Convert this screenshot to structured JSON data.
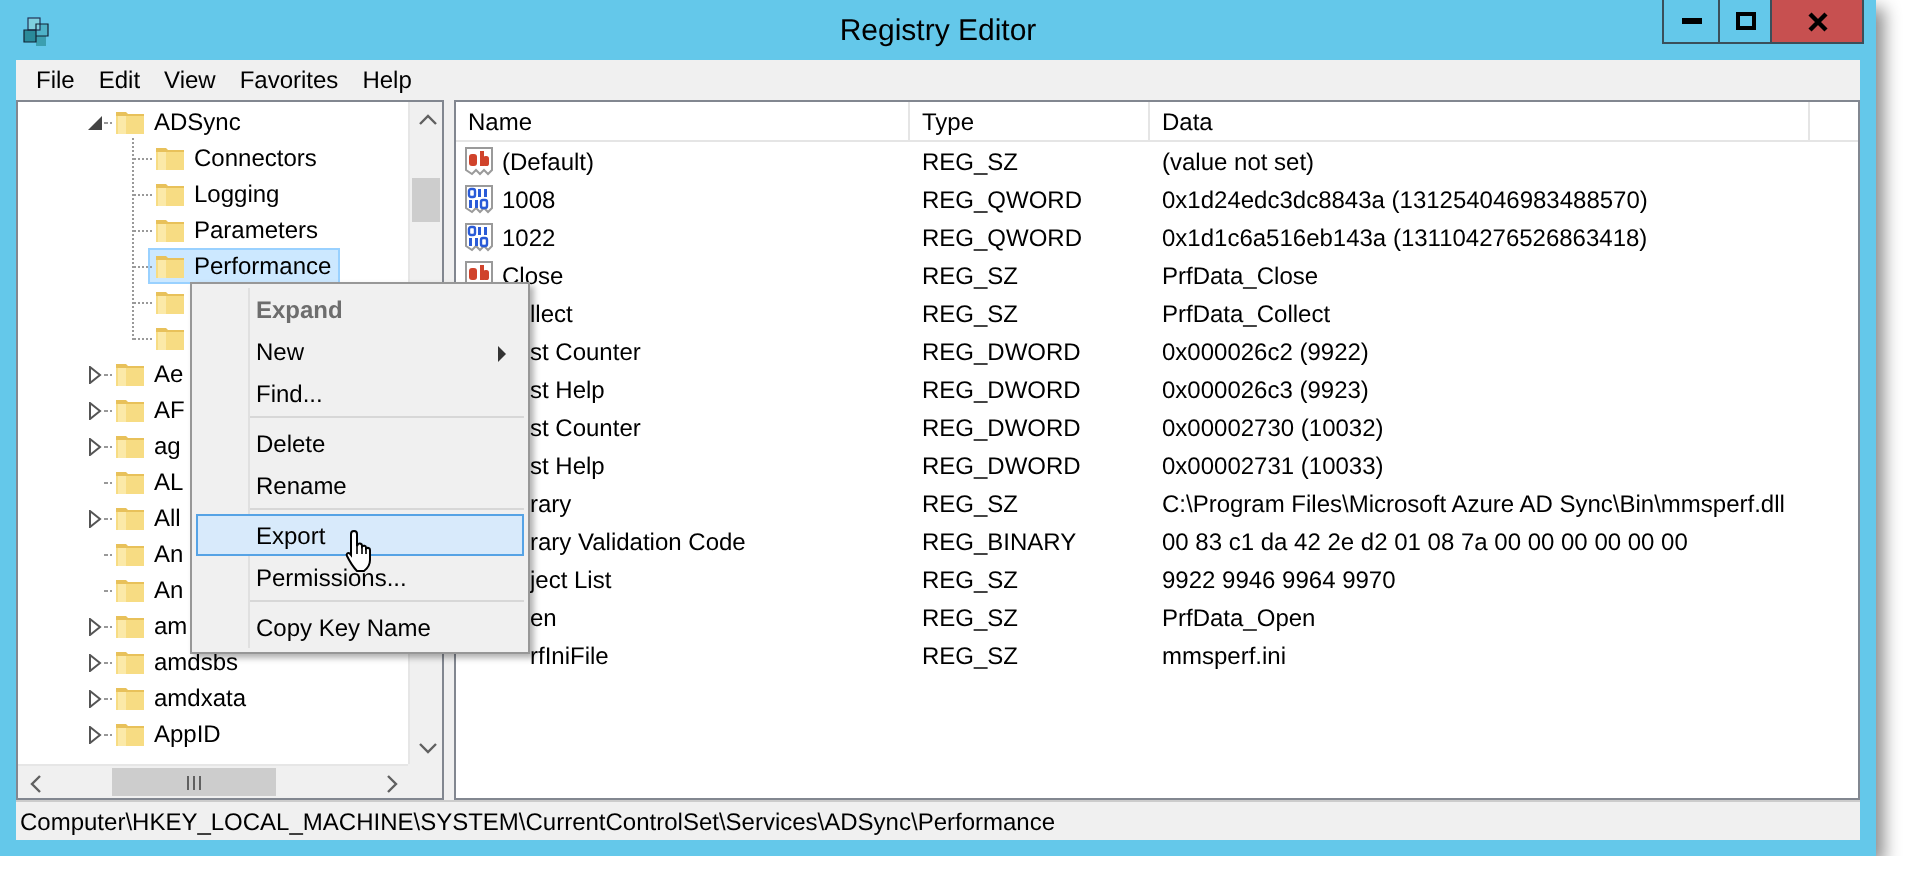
{
  "window": {
    "title": "Registry Editor"
  },
  "menu_bar": [
    "File",
    "Edit",
    "View",
    "Favorites",
    "Help"
  ],
  "tree": {
    "items": [
      {
        "label": "ADSync",
        "kind": "branch",
        "expanded": true,
        "selected": false,
        "children": [
          {
            "label": "Connectors",
            "selected": false
          },
          {
            "label": "Logging",
            "selected": false
          },
          {
            "label": "Parameters",
            "selected": false
          },
          {
            "label": "Performance",
            "selected": true
          },
          {
            "selected": false
          },
          {
            "selected": false
          }
        ]
      },
      {
        "label": "Ae",
        "kind": "branch",
        "expanded": false,
        "selected": false
      },
      {
        "label": "AF",
        "kind": "branch",
        "expanded": false,
        "selected": false
      },
      {
        "label": "ag",
        "kind": "branch",
        "expanded": false,
        "selected": false
      },
      {
        "label": "AL",
        "kind": "leaf",
        "selected": false
      },
      {
        "label": "All",
        "kind": "branch",
        "expanded": false,
        "selected": false
      },
      {
        "label": "An",
        "kind": "leaf",
        "selected": false
      },
      {
        "label": "An",
        "kind": "leaf",
        "selected": false
      },
      {
        "label": "am",
        "kind": "branch",
        "expanded": false,
        "selected": false
      },
      {
        "label": "amdsbs",
        "kind": "branch",
        "expanded": false,
        "selected": false
      },
      {
        "label": "amdxata",
        "kind": "branch",
        "expanded": false,
        "selected": false
      },
      {
        "label": "AppID",
        "kind": "branch",
        "expanded": false,
        "selected": false
      }
    ]
  },
  "values": {
    "columns": [
      "Name",
      "Type",
      "Data"
    ],
    "rows": [
      {
        "kind": "string",
        "name": "(Default)",
        "type": "REG_SZ",
        "data": "(value not set)"
      },
      {
        "kind": "binary",
        "name": "1008",
        "type": "REG_QWORD",
        "data": "0x1d24edc3dc8843a (131254046983488570)"
      },
      {
        "kind": "binary",
        "name": "1022",
        "type": "REG_QWORD",
        "data": "0x1d1c6a516eb143a (131104276526863418)"
      },
      {
        "kind": "string",
        "name": "Close",
        "type": "REG_SZ",
        "data": "PrfData_Close"
      },
      {
        "kind": "covered",
        "name": "llect",
        "type": "REG_SZ",
        "data": "PrfData_Collect"
      },
      {
        "kind": "covered",
        "name": "st Counter",
        "type": "REG_DWORD",
        "data": "0x000026c2 (9922)"
      },
      {
        "kind": "covered",
        "name": "st Help",
        "type": "REG_DWORD",
        "data": "0x000026c3 (9923)"
      },
      {
        "kind": "covered",
        "name": "st Counter",
        "type": "REG_DWORD",
        "data": "0x00002730 (10032)"
      },
      {
        "kind": "covered",
        "name": "st Help",
        "type": "REG_DWORD",
        "data": "0x00002731 (10033)"
      },
      {
        "kind": "covered",
        "name": "rary",
        "type": "REG_SZ",
        "data": "C:\\Program Files\\Microsoft Azure AD Sync\\Bin\\mmsperf.dll"
      },
      {
        "kind": "covered",
        "name": "rary Validation Code",
        "type": "REG_BINARY",
        "data": "00 83 c1 da 42 2e d2 01 08 7a 00 00 00 00 00 00"
      },
      {
        "kind": "covered",
        "name": "ject List",
        "type": "REG_SZ",
        "data": "9922 9946 9964 9970"
      },
      {
        "kind": "covered",
        "name": "en",
        "type": "REG_SZ",
        "data": "PrfData_Open"
      },
      {
        "kind": "covered",
        "name": "rfIniFile",
        "type": "REG_SZ",
        "data": "mmsperf.ini"
      }
    ]
  },
  "context_menu": [
    {
      "kind": "item",
      "label": "Expand",
      "default": true,
      "disabled": true,
      "submenu": false,
      "selected": false
    },
    {
      "kind": "item",
      "label": "New",
      "default": false,
      "disabled": false,
      "submenu": true,
      "selected": false
    },
    {
      "kind": "item",
      "label": "Find...",
      "default": false,
      "disabled": false,
      "submenu": false,
      "selected": false
    },
    {
      "kind": "separator"
    },
    {
      "kind": "item",
      "label": "Delete",
      "default": false,
      "disabled": false,
      "submenu": false,
      "selected": false
    },
    {
      "kind": "item",
      "label": "Rename",
      "default": false,
      "disabled": false,
      "submenu": false,
      "selected": false
    },
    {
      "kind": "separator"
    },
    {
      "kind": "item",
      "label": "Export",
      "default": false,
      "disabled": false,
      "submenu": false,
      "selected": true
    },
    {
      "kind": "item",
      "label": "Permissions...",
      "default": false,
      "disabled": false,
      "submenu": false,
      "selected": false
    },
    {
      "kind": "separator"
    },
    {
      "kind": "item",
      "label": "Copy Key Name",
      "default": false,
      "disabled": false,
      "submenu": false,
      "selected": false
    }
  ],
  "status_bar": "Computer\\HKEY_LOCAL_MACHINE\\SYSTEM\\CurrentControlSet\\Services\\ADSync\\Performance"
}
